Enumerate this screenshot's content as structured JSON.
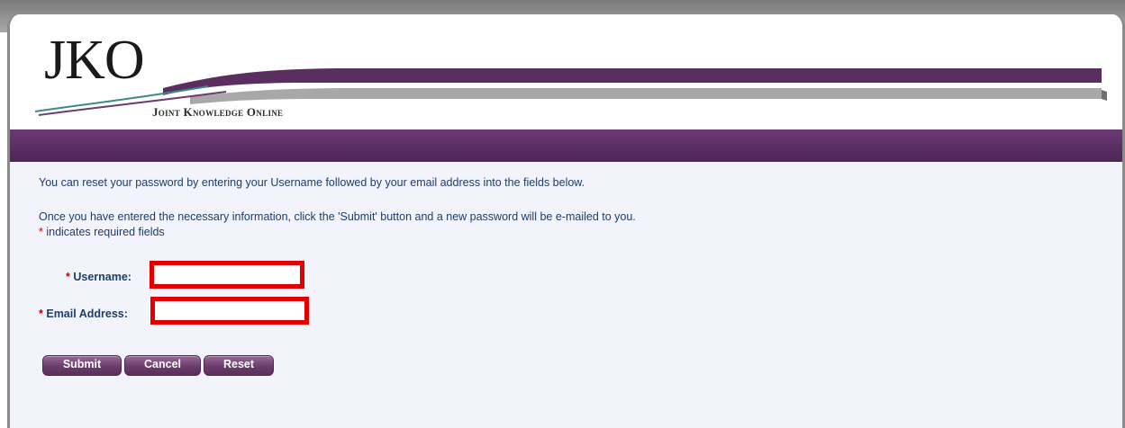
{
  "header": {
    "logo_text": "JKO",
    "tagline": "Joint Knowledge Online",
    "brand_color": "#5a2f60"
  },
  "instructions": {
    "line1": "You can reset your password by entering your Username followed by your email address into the fields below.",
    "line2": "Once you have entered the necessary information, click the 'Submit' button and a new password will be e-mailed to you.",
    "required_star": "*",
    "required_note": " indicates required fields"
  },
  "form": {
    "username": {
      "star": "*",
      "label": "Username:",
      "value": ""
    },
    "email": {
      "star": "*",
      "label": "Email Address:",
      "value": ""
    }
  },
  "buttons": {
    "submit": "Submit",
    "cancel": "Cancel",
    "reset": "Reset"
  },
  "colors": {
    "text": "#1d3d6b",
    "required": "#cc0000",
    "highlight_border": "#e00000",
    "content_bg": "#f3f3fb"
  }
}
